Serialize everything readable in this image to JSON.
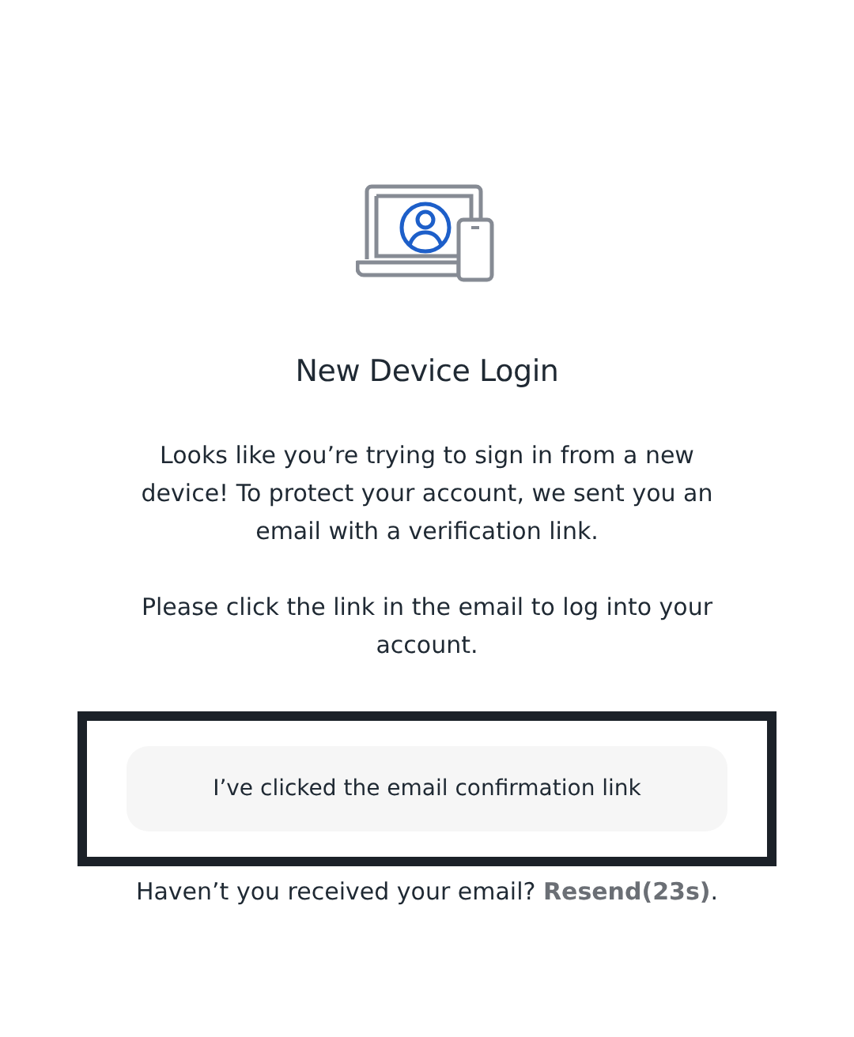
{
  "title": "New Device Login",
  "paragraphs": [
    "Looks like you’re trying to sign in from a new device! To protect your account, we sent you an email with a verification link.",
    "Please click the link in the email to log into your account."
  ],
  "confirm_button": {
    "label": "I’ve clicked the email confirmation link"
  },
  "resend": {
    "prefix": "Haven’t you received your email? ",
    "link": "Resend(23s)",
    "suffix": "."
  }
}
